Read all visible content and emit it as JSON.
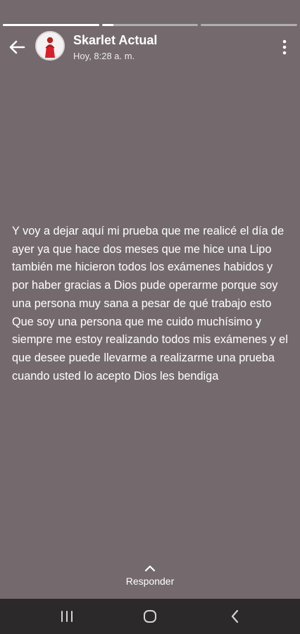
{
  "story": {
    "progress": [
      1.0,
      0.12,
      0.0
    ],
    "user_name": "Skarlet Actual",
    "timestamp": "Hoy, 8:28 a. m.",
    "text": "Y voy a dejar aquí mi prueba que me realicé el día de ayer ya que hace dos meses que me hice una Lipo también me hicieron todos los exámenes habidos y por haber gracias a Dios pude operarme porque soy una persona muy sana a pesar de qué trabajo esto Que soy una persona que me cuido muchísimo y siempre me estoy realizando todos mis exámenes y el que desee puede llevarme a realizarme una prueba cuando usted lo acepto Dios les bendiga"
  },
  "reply": {
    "label": "Responder"
  },
  "icons": {
    "back": "arrow-left-icon",
    "avatar": "profile-photo",
    "menu": "more-vertical-icon",
    "reply": "chevron-up-icon",
    "nav_recents": "recent-apps-icon",
    "nav_home": "home-icon",
    "nav_back": "back-icon"
  },
  "colors": {
    "background": "#746a6d",
    "text": "#ffffff",
    "navbar": "#2b2929",
    "avatar_accent": "#d8202a"
  }
}
